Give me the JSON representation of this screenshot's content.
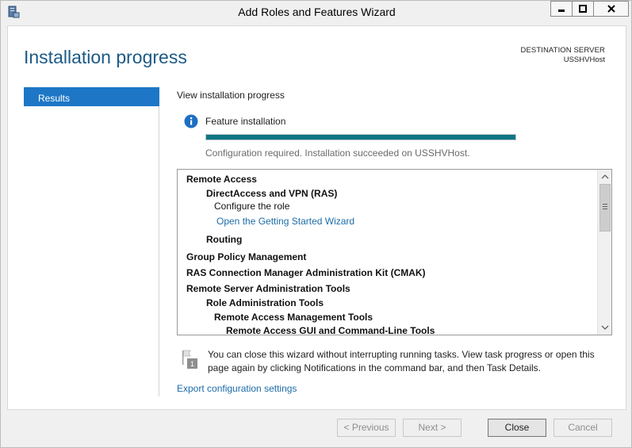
{
  "window": {
    "title": "Add Roles and Features Wizard"
  },
  "header": {
    "page_title": "Installation progress",
    "destination_label": "DESTINATION SERVER",
    "destination_value": "USSHVHost"
  },
  "nav": {
    "items": [
      {
        "label": "Results",
        "selected": true
      }
    ]
  },
  "content": {
    "view_label": "View installation progress",
    "feature_label": "Feature installation",
    "progress": 1.0,
    "status_text": "Configuration required. Installation succeeded on USSHVHost.",
    "results": [
      {
        "text": "Remote Access",
        "level": 0,
        "bold": true
      },
      {
        "text": "DirectAccess and VPN (RAS)",
        "level": 1,
        "bold": true
      },
      {
        "text": "Configure the role",
        "level": 2,
        "bold": false
      },
      {
        "text": "Open the Getting Started Wizard",
        "level": 2,
        "link": true
      },
      {
        "text": "Routing",
        "level": 1,
        "bold": true
      },
      {
        "text": "Group Policy Management",
        "level": 0,
        "bold": true
      },
      {
        "text": "RAS Connection Manager Administration Kit (CMAK)",
        "level": 0,
        "bold": true
      },
      {
        "text": "Remote Server Administration Tools",
        "level": 0,
        "bold": true
      },
      {
        "text": "Role Administration Tools",
        "level": 1,
        "bold": true
      },
      {
        "text": "Remote Access Management Tools",
        "level": 2,
        "bold": true
      },
      {
        "text": "Remote Access GUI and Command-Line Tools",
        "level": 3,
        "bold": true
      }
    ],
    "note_line1": "You can close this wizard without interrupting running tasks. View task progress or open this",
    "note_line2": "page again by clicking Notifications in the command bar, and then Task Details.",
    "note_badge": "1",
    "export_link": "Export configuration settings"
  },
  "footer": {
    "previous_label": "< Previous",
    "next_label": "Next >",
    "close_label": "Close",
    "cancel_label": "Cancel"
  },
  "colors": {
    "accent": "#1d77c6",
    "title": "#1c5a87",
    "progress": "#0f7685",
    "link": "#1c6ca8"
  },
  "icons": {
    "app": "server-manager-icon",
    "info": "info-icon",
    "flag": "flag-icon"
  }
}
